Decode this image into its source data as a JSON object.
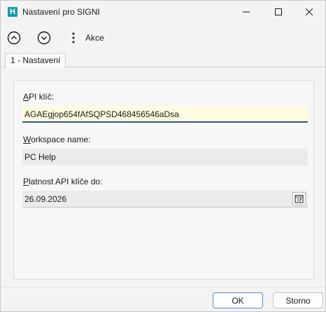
{
  "window": {
    "title": "Nastavení pro SIGNI",
    "app_icon_letter": "H"
  },
  "toolbar": {
    "up_icon": "chevron-up-circle-icon",
    "down_icon": "chevron-down-circle-icon",
    "more_icon": "kebab-icon",
    "akce_label": "Akce"
  },
  "tabs": [
    {
      "label": "1 - Nastavení",
      "active": true
    }
  ],
  "form": {
    "api_key": {
      "label_first": "A",
      "label_rest": "PI klíč:",
      "value": "AGAEgjop654fAfSQPSD468456546aDsa"
    },
    "workspace": {
      "label_first": "W",
      "label_rest": "orkspace name:",
      "value": "PC Help"
    },
    "validity": {
      "label_first": "P",
      "label_rest": "latnost API klíče do:",
      "value": "26.09.2026",
      "calendar_icon": "calendar-icon"
    }
  },
  "buttons": {
    "ok_label": "OK",
    "storno_label": "Storno"
  },
  "colors": {
    "app_icon": "#1a9aa8",
    "api_field_bg": "#fffbe0",
    "api_field_border": "#2b5a8c",
    "ok_border": "#5a8fc7"
  }
}
